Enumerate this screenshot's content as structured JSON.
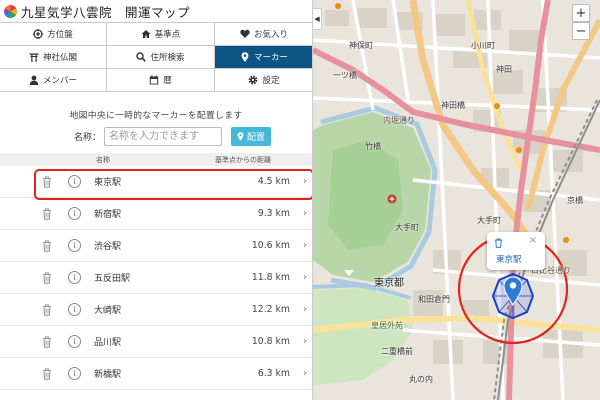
{
  "header": {
    "title": "九星気学八雲院　開運マップ"
  },
  "nav": [
    {
      "label": "方位盤",
      "icon": "compass-icon"
    },
    {
      "label": "基準点",
      "icon": "home-icon"
    },
    {
      "label": "お気入り",
      "icon": "heart-icon"
    },
    {
      "label": "神社仏閣",
      "icon": "torii-icon"
    },
    {
      "label": "住所検索",
      "icon": "search-icon"
    },
    {
      "label": "マーカー",
      "icon": "map-marker-icon",
      "active": true
    },
    {
      "label": "メンバー",
      "icon": "user-icon"
    },
    {
      "label": "暦",
      "icon": "calendar-icon"
    },
    {
      "label": "設定",
      "icon": "gear-icon"
    }
  ],
  "marker_form": {
    "instruction": "地図中央に一時的なマーカーを配置します",
    "name_label": "名称：",
    "name_placeholder": "名称を入力できます",
    "place_button": "配置"
  },
  "table": {
    "col_name": "名称",
    "col_distance": "基準点からの距離",
    "rows": [
      {
        "name": "東京駅",
        "distance": "4.5 km",
        "highlighted": true
      },
      {
        "name": "新宿駅",
        "distance": "9.3 km"
      },
      {
        "name": "渋谷駅",
        "distance": "10.6 km"
      },
      {
        "name": "五反田駅",
        "distance": "11.8 km"
      },
      {
        "name": "大崎駅",
        "distance": "12.2 km"
      },
      {
        "name": "品川駅",
        "distance": "10.8 km"
      },
      {
        "name": "新橋駅",
        "distance": "6.3 km"
      }
    ]
  },
  "map": {
    "zoom_in": "+",
    "zoom_out": "−",
    "collapse": "◀",
    "popup": {
      "name": "東京駅",
      "close": "×"
    },
    "labels": [
      {
        "t": "神保町",
        "cls": ""
      },
      {
        "t": "小川町",
        "cls": ""
      },
      {
        "t": "神田",
        "cls": ""
      },
      {
        "t": "竹橋",
        "cls": ""
      },
      {
        "t": "内堀通り",
        "cls": "road"
      },
      {
        "t": "大手町",
        "cls": ""
      },
      {
        "t": "大手町",
        "cls": ""
      },
      {
        "t": "東京都",
        "cls": "big"
      },
      {
        "t": "皇居外苑",
        "cls": "green"
      },
      {
        "t": "二重橋前",
        "cls": ""
      },
      {
        "t": "丸の内",
        "cls": ""
      },
      {
        "t": "日比谷通り",
        "cls": "road"
      },
      {
        "t": "和田倉門",
        "cls": ""
      },
      {
        "t": "京橋",
        "cls": ""
      },
      {
        "t": "一ツ橋",
        "cls": ""
      },
      {
        "t": "神田橋",
        "cls": ""
      }
    ],
    "colors": {
      "marker": "#2f7bd6",
      "octagon": "#1c3fd0",
      "circle": "#e2231a"
    }
  }
}
